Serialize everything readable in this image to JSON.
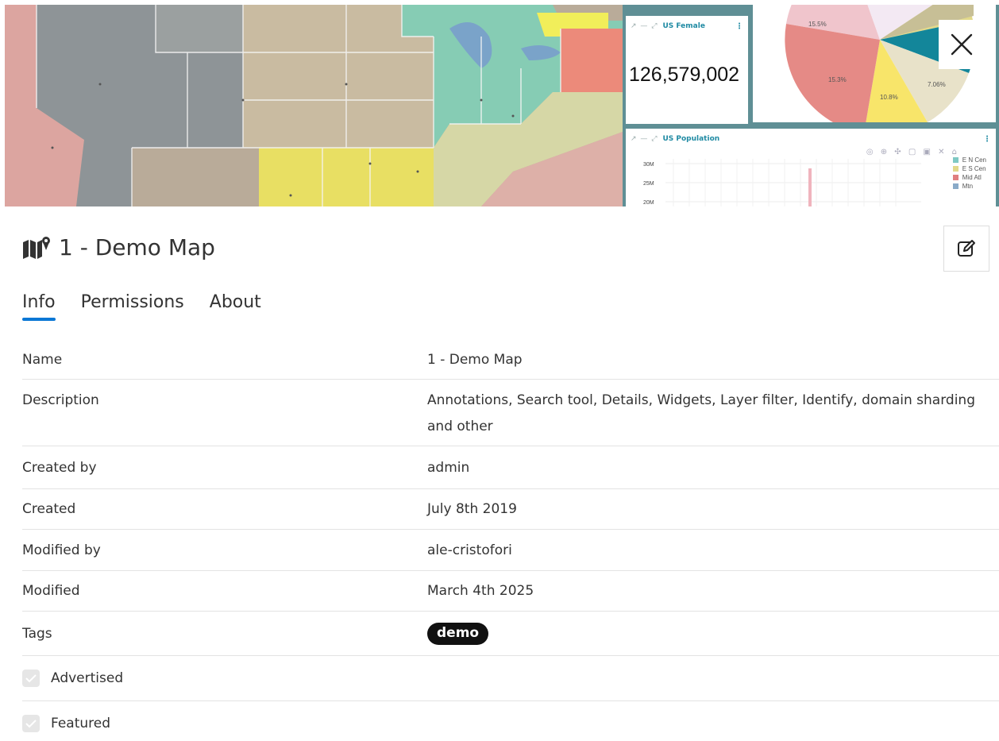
{
  "preview": {
    "female_widget": {
      "title": "US Female",
      "value": "126,579,002"
    },
    "pie_widget": {
      "labels": [
        "15.5%",
        "15.3%",
        "10.8%",
        "7.06%"
      ]
    },
    "population_widget": {
      "title": "US Population",
      "y_ticks": [
        "30M",
        "25M",
        "20M"
      ],
      "legend": [
        {
          "name": "E N Cen",
          "color": "#7fc9c4"
        },
        {
          "name": "E S Cen",
          "color": "#e2d98a"
        },
        {
          "name": "Mid Atl",
          "color": "#e07f7f"
        },
        {
          "name": "Mtn",
          "color": "#8aaac8"
        }
      ]
    }
  },
  "resource": {
    "title": "1 - Demo Map",
    "icon": "map-icon"
  },
  "tabs": [
    {
      "label": "Info",
      "active": true
    },
    {
      "label": "Permissions",
      "active": false
    },
    {
      "label": "About",
      "active": false
    }
  ],
  "info": {
    "rows": [
      {
        "key": "Name",
        "value": "1 - Demo Map"
      },
      {
        "key": "Description",
        "value": "Annotations, Search tool, Details, Widgets, Layer filter, Identify, domain sharding and other"
      },
      {
        "key": "Created by",
        "value": "admin"
      },
      {
        "key": "Created",
        "value": "July 8th 2019"
      },
      {
        "key": "Modified by",
        "value": "ale-cristofori"
      },
      {
        "key": "Modified",
        "value": "March 4th 2025"
      }
    ],
    "tags_label": "Tags",
    "tag": "demo",
    "advertised_label": "Advertised",
    "featured_label": "Featured"
  }
}
